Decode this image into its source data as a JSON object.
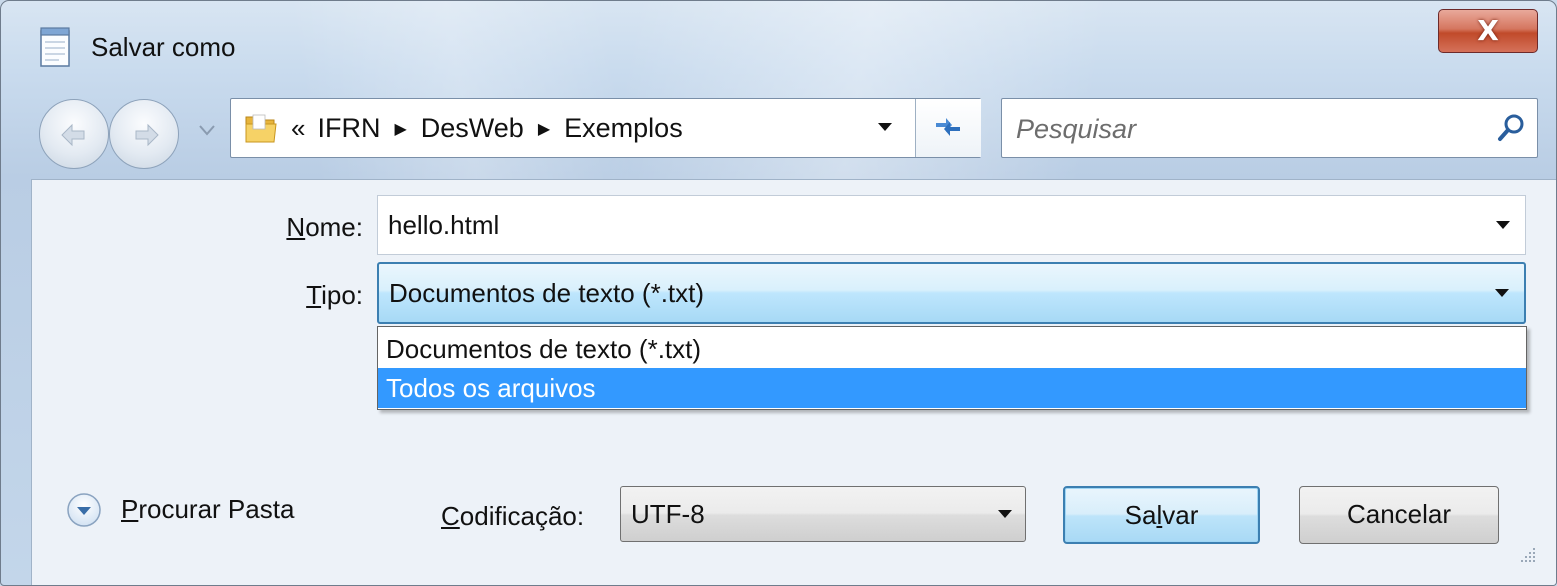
{
  "window": {
    "title": "Salvar como",
    "close_label": "X"
  },
  "navigation": {
    "breadcrumb_lead": "«",
    "breadcrumb": [
      "IFRN",
      "DesWeb",
      "Exemplos"
    ],
    "search_placeholder": "Pesquisar"
  },
  "form": {
    "name_label_accel": "N",
    "name_label_rest": "ome:",
    "name_value": "hello.html",
    "type_label_accel": "T",
    "type_label_rest": "ipo:",
    "type_value": "Documentos de texto (*.txt)",
    "type_options": [
      "Documentos de texto (*.txt)",
      "Todos os arquivos"
    ],
    "type_highlighted_option": "Todos os arquivos"
  },
  "footer": {
    "browse_accel": "P",
    "browse_rest": "rocurar Pasta",
    "encoding_label_accel": "C",
    "encoding_label_rest": "odificação:",
    "encoding_value": "UTF-8",
    "save_pre": "Sa",
    "save_accel": "l",
    "save_post": "var",
    "cancel_label": "Cancelar"
  },
  "colors": {
    "selection": "#3399ff",
    "focus_border": "#3c7fb1",
    "close_button": "#c04a2a"
  },
  "icons": [
    "notepad-icon",
    "close-icon",
    "back-arrow-icon",
    "forward-arrow-icon",
    "chevron-down-icon",
    "folder-icon",
    "refresh-icon",
    "search-icon",
    "expand-circle-icon",
    "resize-grip-icon"
  ]
}
